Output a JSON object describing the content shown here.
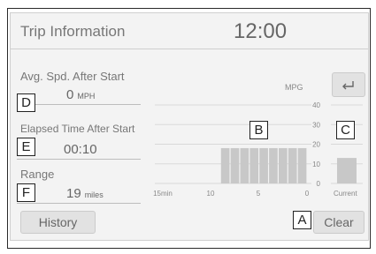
{
  "header": {
    "title": "Trip Information",
    "clock": "12:00"
  },
  "stats": {
    "avg_speed": {
      "label": "Avg. Spd. After Start",
      "value": "0",
      "unit": "MPH",
      "callout": "D"
    },
    "elapsed": {
      "label": "Elapsed Time After Start",
      "value": "00:10",
      "callout": "E"
    },
    "range": {
      "label": "Range",
      "value": "19",
      "unit": "miles",
      "callout": "F"
    }
  },
  "chart_callouts": {
    "graph": "B",
    "current": "C",
    "clear": "A"
  },
  "buttons": {
    "history": "History",
    "clear": "Clear",
    "back_icon": "return-arrow-icon"
  },
  "chart_data": {
    "type": "bar",
    "ylabel": "MPG",
    "ylim": [
      0,
      40
    ],
    "yticks": [
      "0",
      "10",
      "20",
      "30",
      "40"
    ],
    "xticks": [
      "15min",
      "10",
      "5",
      "0"
    ],
    "x_per_bar_minutes": 1,
    "history_values": [
      0,
      0,
      0,
      0,
      0,
      0,
      18,
      18,
      18,
      18,
      18,
      18,
      18,
      18,
      18
    ],
    "current_label": "Current",
    "current_value": 13
  }
}
